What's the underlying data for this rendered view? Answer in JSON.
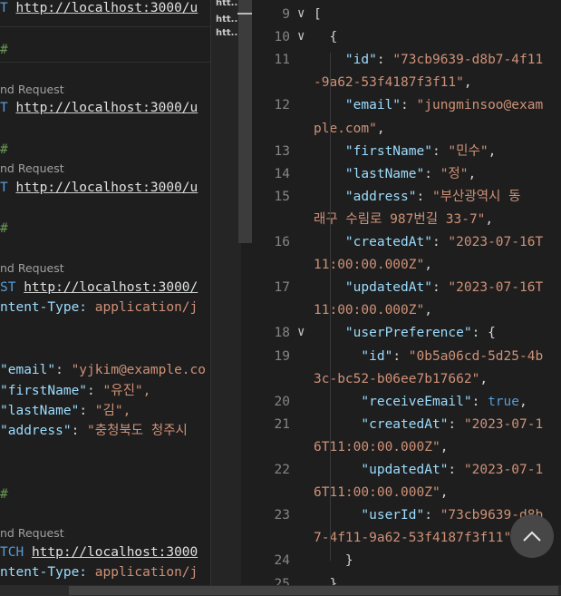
{
  "left": {
    "line1": {
      "method": "T",
      "url": "http://localhost:3000/u"
    },
    "sep1": "#",
    "lens2": "nd Request",
    "line2": {
      "method": "T",
      "url": "http://localhost:3000/u"
    },
    "sep2": "#",
    "lens3": "nd Request",
    "line3": {
      "method": "T",
      "url": "http://localhost:3000/u"
    },
    "sep3": "#",
    "lens4": "nd Request",
    "line4": {
      "method": "ST",
      "url": "http://localhost:3000/"
    },
    "header4": {
      "key": "ntent-Type:",
      "val": "application/j"
    },
    "body": [
      {
        "key": "\"email\"",
        "val": "\"yjkim@example.co"
      },
      {
        "key": "\"firstName\"",
        "val": "\"유진\","
      },
      {
        "key": "\"lastName\"",
        "val": "\"김\","
      },
      {
        "key": "\"address\"",
        "val": "\"충청북도 청주시"
      }
    ],
    "sep5": "#",
    "lens5": "nd Request",
    "line5": {
      "method": "TCH",
      "url": "http://localhost:3000"
    },
    "header5": {
      "key": "ntent-Type:",
      "val": "application/j"
    }
  },
  "tabs": [
    "htt...",
    "htt...",
    "htt..."
  ],
  "response": {
    "lines": [
      {
        "num": "9",
        "fold": true,
        "parts": [
          [
            "punc",
            "["
          ]
        ]
      },
      {
        "num": "10",
        "fold": true,
        "parts": [
          [
            "punc",
            "  {"
          ]
        ]
      },
      {
        "num": "11",
        "parts": [
          [
            "punc",
            "    "
          ],
          [
            "jkey",
            "\"id\""
          ],
          [
            "punc",
            ": "
          ],
          [
            "jstr",
            "\"73cb9639-d8b7-4f11"
          ]
        ]
      },
      {
        "num": "",
        "parts": [
          [
            "jstr",
            "-9a62-53f4187f3f11\""
          ],
          [
            "punc",
            ","
          ]
        ]
      },
      {
        "num": "12",
        "parts": [
          [
            "punc",
            "    "
          ],
          [
            "jkey",
            "\"email\""
          ],
          [
            "punc",
            ": "
          ],
          [
            "jstr",
            "\"jungminsoo@exam"
          ]
        ]
      },
      {
        "num": "",
        "parts": [
          [
            "jstr",
            "ple.com\""
          ],
          [
            "punc",
            ","
          ]
        ]
      },
      {
        "num": "13",
        "parts": [
          [
            "punc",
            "    "
          ],
          [
            "jkey",
            "\"firstName\""
          ],
          [
            "punc",
            ": "
          ],
          [
            "jstr",
            "\"민수\""
          ],
          [
            "punc",
            ","
          ]
        ]
      },
      {
        "num": "14",
        "parts": [
          [
            "punc",
            "    "
          ],
          [
            "jkey",
            "\"lastName\""
          ],
          [
            "punc",
            ": "
          ],
          [
            "jstr",
            "\"정\""
          ],
          [
            "punc",
            ","
          ]
        ]
      },
      {
        "num": "15",
        "parts": [
          [
            "punc",
            "    "
          ],
          [
            "jkey",
            "\"address\""
          ],
          [
            "punc",
            ": "
          ],
          [
            "jstr",
            "\"부산광역시 동"
          ]
        ]
      },
      {
        "num": "",
        "parts": [
          [
            "jstr",
            "래구 수림로 987번길 33-7\""
          ],
          [
            "punc",
            ","
          ]
        ]
      },
      {
        "num": "16",
        "parts": [
          [
            "punc",
            "    "
          ],
          [
            "jkey",
            "\"createdAt\""
          ],
          [
            "punc",
            ": "
          ],
          [
            "jstr",
            "\"2023-07-16T"
          ]
        ]
      },
      {
        "num": "",
        "parts": [
          [
            "jstr",
            "11:00:00.000Z\""
          ],
          [
            "punc",
            ","
          ]
        ]
      },
      {
        "num": "17",
        "parts": [
          [
            "punc",
            "    "
          ],
          [
            "jkey",
            "\"updatedAt\""
          ],
          [
            "punc",
            ": "
          ],
          [
            "jstr",
            "\"2023-07-16T"
          ]
        ]
      },
      {
        "num": "",
        "parts": [
          [
            "jstr",
            "11:00:00.000Z\""
          ],
          [
            "punc",
            ","
          ]
        ]
      },
      {
        "num": "18",
        "fold": true,
        "parts": [
          [
            "punc",
            "    "
          ],
          [
            "jkey",
            "\"userPreference\""
          ],
          [
            "punc",
            ": {"
          ]
        ]
      },
      {
        "num": "19",
        "parts": [
          [
            "punc",
            "      "
          ],
          [
            "jkey",
            "\"id\""
          ],
          [
            "punc",
            ": "
          ],
          [
            "jstr",
            "\"0b5a06cd-5d25-4b"
          ]
        ]
      },
      {
        "num": "",
        "parts": [
          [
            "jstr",
            "3c-bc52-b06ee7b17662\""
          ],
          [
            "punc",
            ","
          ]
        ]
      },
      {
        "num": "20",
        "parts": [
          [
            "punc",
            "      "
          ],
          [
            "jkey",
            "\"receiveEmail\""
          ],
          [
            "punc",
            ": "
          ],
          [
            "kw",
            "true"
          ],
          [
            "punc",
            ","
          ]
        ]
      },
      {
        "num": "21",
        "parts": [
          [
            "punc",
            "      "
          ],
          [
            "jkey",
            "\"createdAt\""
          ],
          [
            "punc",
            ": "
          ],
          [
            "jstr",
            "\"2023-07-1"
          ]
        ]
      },
      {
        "num": "",
        "parts": [
          [
            "jstr",
            "6T11:00:00.000Z\""
          ],
          [
            "punc",
            ","
          ]
        ]
      },
      {
        "num": "22",
        "parts": [
          [
            "punc",
            "      "
          ],
          [
            "jkey",
            "\"updatedAt\""
          ],
          [
            "punc",
            ": "
          ],
          [
            "jstr",
            "\"2023-07-1"
          ]
        ]
      },
      {
        "num": "",
        "parts": [
          [
            "jstr",
            "6T11:00:00.000Z\""
          ],
          [
            "punc",
            ","
          ]
        ]
      },
      {
        "num": "23",
        "parts": [
          [
            "punc",
            "      "
          ],
          [
            "jkey",
            "\"userId\""
          ],
          [
            "punc",
            ": "
          ],
          [
            "jstr",
            "\"73cb9639-d8b"
          ]
        ]
      },
      {
        "num": "",
        "parts": [
          [
            "jstr",
            "7-4f11-9a62-53f4187f3f11\""
          ]
        ]
      },
      {
        "num": "24",
        "parts": [
          [
            "punc",
            "    }"
          ]
        ]
      },
      {
        "num": "25",
        "parts": [
          [
            "punc",
            "  }"
          ]
        ]
      }
    ]
  }
}
